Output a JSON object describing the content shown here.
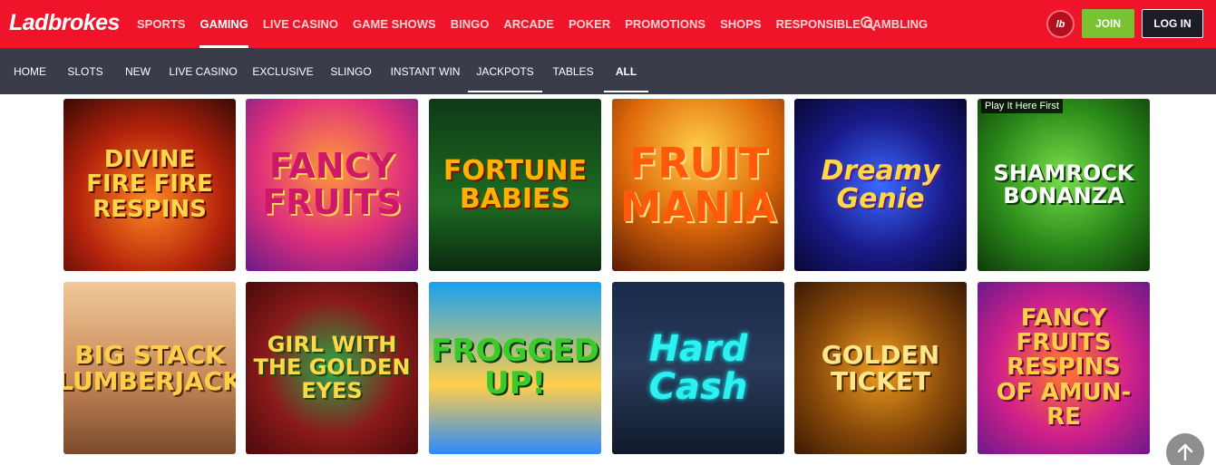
{
  "brand": {
    "logo": "Ladbrokes",
    "badge": "lb"
  },
  "main_nav": [
    {
      "label": "SPORTS",
      "active": false
    },
    {
      "label": "GAMING",
      "active": true
    },
    {
      "label": "LIVE CASINO",
      "active": false
    },
    {
      "label": "GAME SHOWS",
      "active": false
    },
    {
      "label": "BINGO",
      "active": false
    },
    {
      "label": "ARCADE",
      "active": false
    },
    {
      "label": "POKER",
      "active": false
    },
    {
      "label": "PROMOTIONS",
      "active": false
    },
    {
      "label": "SHOPS",
      "active": false
    },
    {
      "label": "RESPONSIBLE GAMBLING",
      "active": false
    }
  ],
  "header_buttons": {
    "join": "JOIN",
    "login": "LOG IN"
  },
  "sub_nav": [
    {
      "label": "HOME"
    },
    {
      "label": "SLOTS"
    },
    {
      "label": "NEW"
    },
    {
      "label": "LIVE CASINO"
    },
    {
      "label": "EXCLUSIVE"
    },
    {
      "label": "SLINGO"
    },
    {
      "label": "INSTANT WIN"
    },
    {
      "label": "JACKPOTS"
    },
    {
      "label": "TABLES"
    },
    {
      "label": "ALL",
      "active": true
    }
  ],
  "games": [
    {
      "title": "DIVINE FIRE FIRE RESPINS",
      "tag": ""
    },
    {
      "title": "FANCY FRUITS",
      "tag": ""
    },
    {
      "title": "FORTUNE BABIES",
      "tag": ""
    },
    {
      "title": "FRUIT MANIA",
      "tag": ""
    },
    {
      "title": "Dreamy Genie",
      "tag": ""
    },
    {
      "title": "SHAMROCK BONANZA",
      "tag": "Play It Here First"
    },
    {
      "title": "BIG STACK LUMBERJACK",
      "tag": ""
    },
    {
      "title": "GIRL WITH THE GOLDEN EYES",
      "tag": ""
    },
    {
      "title": "FROGGED UP!",
      "tag": ""
    },
    {
      "title": "Hard Cash",
      "tag": ""
    },
    {
      "title": "GOLDEN TICKET",
      "tag": ""
    },
    {
      "title": "FANCY FRUITS RESPINS OF AMUN-RE",
      "tag": ""
    }
  ],
  "colors": {
    "header_red": "#f0142a",
    "subnav_bg": "#3a3c4a",
    "join_green": "#7ac231",
    "login_dark": "#1d1d28"
  },
  "icons": {
    "search": "search-icon",
    "scroll_top": "arrow-up-icon"
  }
}
